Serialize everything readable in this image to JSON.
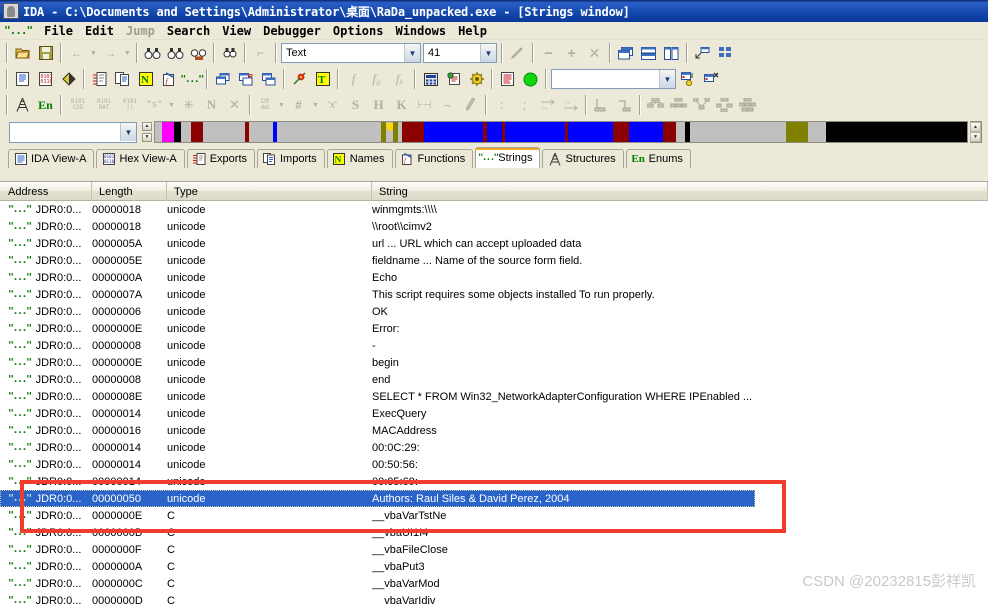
{
  "window": {
    "title": "IDA - C:\\Documents and Settings\\Administrator\\桌面\\RaDa_unpacked.exe - [Strings window]",
    "icon": "ida-logo-icon"
  },
  "menu": {
    "quote_icon": "\"...\"",
    "items": [
      {
        "label": "File",
        "dim": false
      },
      {
        "label": "Edit",
        "dim": false
      },
      {
        "label": "Jump",
        "dim": true
      },
      {
        "label": "Search",
        "dim": false
      },
      {
        "label": "View",
        "dim": false
      },
      {
        "label": "Debugger",
        "dim": false
      },
      {
        "label": "Options",
        "dim": false
      },
      {
        "label": "Windows",
        "dim": false
      },
      {
        "label": "Help",
        "dim": false
      }
    ]
  },
  "toolbar": {
    "search_type_combo": {
      "value": "Text",
      "placeholder": "Text"
    },
    "count_combo": {
      "value": "41",
      "placeholder": "41"
    },
    "name_combo": {
      "value": "",
      "placeholder": ""
    }
  },
  "navigator": {
    "address_combo": {
      "value": "",
      "placeholder": ""
    },
    "marker_label": "cursor-position-marker",
    "segments": [
      {
        "color": "#c0c0c0",
        "width": 1.0
      },
      {
        "color": "#ff00ff",
        "width": 1.6
      },
      {
        "color": "#000000",
        "width": 0.9
      },
      {
        "color": "#c0c0c0",
        "width": 1.4
      },
      {
        "color": "#8b0000",
        "width": 1.6
      },
      {
        "color": "#c0c0c0",
        "width": 5.6
      },
      {
        "color": "#8b0000",
        "width": 0.6
      },
      {
        "color": "#c0c0c0",
        "width": 3.2
      },
      {
        "color": "#0000ff",
        "width": 0.6
      },
      {
        "color": "#c0c0c0",
        "width": 14.0
      },
      {
        "color": "#808000",
        "width": 0.7
      },
      {
        "color": "#c0c0c0",
        "width": 0.9
      },
      {
        "color": "#808000",
        "width": 0.7
      },
      {
        "color": "#c0c0c0",
        "width": 0.5
      },
      {
        "color": "#8b0000",
        "width": 3.0
      },
      {
        "color": "#0000ff",
        "width": 8.0
      },
      {
        "color": "#8b0000",
        "width": 0.5
      },
      {
        "color": "#0000ff",
        "width": 2.0
      },
      {
        "color": "#8b0000",
        "width": 0.5
      },
      {
        "color": "#0000ff",
        "width": 8.0
      },
      {
        "color": "#8b0000",
        "width": 0.5
      },
      {
        "color": "#0000ff",
        "width": 6.0
      },
      {
        "color": "#8b0000",
        "width": 2.2
      },
      {
        "color": "#0000ff",
        "width": 4.6
      },
      {
        "color": "#8b0000",
        "width": 1.8
      },
      {
        "color": "#c0c0c0",
        "width": 1.2
      },
      {
        "color": "#000000",
        "width": 0.6
      },
      {
        "color": "#c0c0c0",
        "width": 13.0
      },
      {
        "color": "#808000",
        "width": 3.0
      },
      {
        "color": "#c0c0c0",
        "width": 2.4
      },
      {
        "color": "#000000",
        "width": 19.0
      }
    ]
  },
  "tabs": [
    {
      "label": "IDA View-A",
      "icon": "document-icon",
      "active": false
    },
    {
      "label": "Hex View-A",
      "icon": "hex-icon",
      "active": false
    },
    {
      "label": "Exports",
      "icon": "exports-icon",
      "active": false
    },
    {
      "label": "Imports",
      "icon": "imports-icon",
      "active": false
    },
    {
      "label": "Names",
      "icon": "names-icon",
      "active": false
    },
    {
      "label": "Functions",
      "icon": "functions-icon",
      "active": false
    },
    {
      "label": "Strings",
      "icon": "strings-icon",
      "active": true
    },
    {
      "label": "Structures",
      "icon": "structures-icon",
      "active": false
    },
    {
      "label": "Enums",
      "icon": "enums-icon",
      "active": false
    }
  ],
  "table": {
    "columns": [
      "Address",
      "Length",
      "Type",
      "String"
    ],
    "rows": [
      {
        "address": "JDR0:0...",
        "length": "00000018",
        "type": "unicode",
        "string": "winmgmts:\\\\\\\\",
        "selected": false
      },
      {
        "address": "JDR0:0...",
        "length": "00000018",
        "type": "unicode",
        "string": "\\\\root\\\\cimv2",
        "selected": false
      },
      {
        "address": "JDR0:0...",
        "length": "0000005A",
        "type": "unicode",
        "string": "  url ... URL which can accept uploaded data",
        "selected": false
      },
      {
        "address": "JDR0:0...",
        "length": "0000005E",
        "type": "unicode",
        "string": "  fieldname ... Name of the source form field.",
        "selected": false
      },
      {
        "address": "JDR0:0...",
        "length": "0000000A",
        "type": "unicode",
        "string": "Echo",
        "selected": false
      },
      {
        "address": "JDR0:0...",
        "length": "0000007A",
        "type": "unicode",
        "string": "This script requires some objects installed To run properly.",
        "selected": false
      },
      {
        "address": "JDR0:0...",
        "length": "00000006",
        "type": "unicode",
        "string": "OK",
        "selected": false
      },
      {
        "address": "JDR0:0...",
        "length": "0000000E",
        "type": "unicode",
        "string": "Error:",
        "selected": false
      },
      {
        "address": "JDR0:0...",
        "length": "00000008",
        "type": "unicode",
        "string": " -",
        "selected": false
      },
      {
        "address": "JDR0:0...",
        "length": "0000000E",
        "type": "unicode",
        "string": "begin",
        "selected": false
      },
      {
        "address": "JDR0:0...",
        "length": "00000008",
        "type": "unicode",
        "string": "end",
        "selected": false
      },
      {
        "address": "JDR0:0...",
        "length": "0000008E",
        "type": "unicode",
        "string": "SELECT * FROM Win32_NetworkAdapterConfiguration WHERE IPEnabled ...",
        "selected": false
      },
      {
        "address": "JDR0:0...",
        "length": "00000014",
        "type": "unicode",
        "string": "ExecQuery",
        "selected": false
      },
      {
        "address": "JDR0:0...",
        "length": "00000016",
        "type": "unicode",
        "string": "MACAddress",
        "selected": false
      },
      {
        "address": "JDR0:0...",
        "length": "00000014",
        "type": "unicode",
        "string": "00:0C:29:",
        "selected": false
      },
      {
        "address": "JDR0:0...",
        "length": "00000014",
        "type": "unicode",
        "string": "00:50:56:",
        "selected": false
      },
      {
        "address": "JDR0:0...",
        "length": "00000014",
        "type": "unicode",
        "string": "00:05:69:",
        "selected": false
      },
      {
        "address": "JDR0:0...",
        "length": "00000050",
        "type": "unicode",
        "string": "Authors: Raul Siles & David Perez, 2004",
        "selected": true
      },
      {
        "address": "JDR0:0...",
        "length": "0000000E",
        "type": "C",
        "string": "__vbaVarTstNe",
        "selected": false
      },
      {
        "address": "JDR0:0...",
        "length": "0000000B",
        "type": "C",
        "string": "__vbaUI1I4",
        "selected": false
      },
      {
        "address": "JDR0:0...",
        "length": "0000000F",
        "type": "C",
        "string": "__vbaFileClose",
        "selected": false
      },
      {
        "address": "JDR0:0...",
        "length": "0000000A",
        "type": "C",
        "string": "__vbaPut3",
        "selected": false
      },
      {
        "address": "JDR0:0...",
        "length": "0000000C",
        "type": "C",
        "string": "__vbaVarMod",
        "selected": false
      },
      {
        "address": "JDR0:0...",
        "length": "0000000D",
        "type": "C",
        "string": "__vbaVarIdiv",
        "selected": false
      }
    ],
    "row_icon": "\"...\""
  },
  "annotation": {
    "highlight_color": "#f23c2e",
    "name": "red-highlight-box"
  },
  "watermark": {
    "text": "CSDN @20232815彭祥凯"
  }
}
